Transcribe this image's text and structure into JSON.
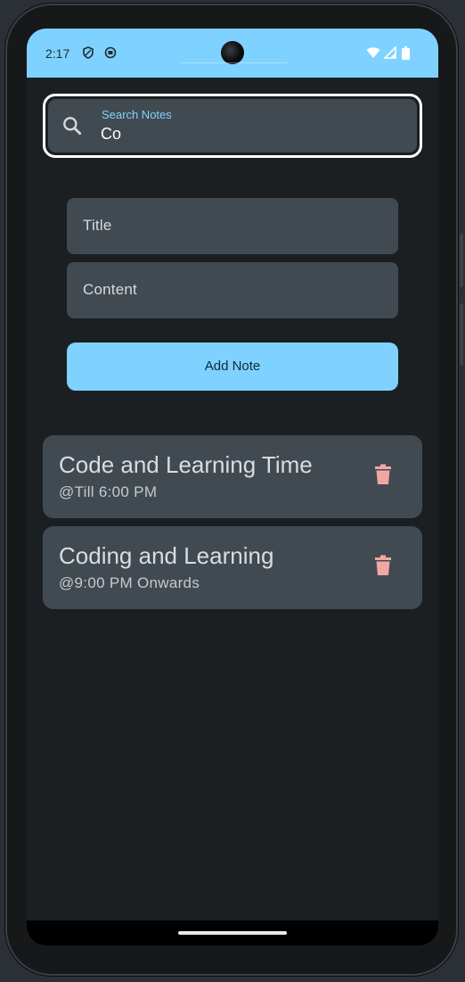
{
  "status_bar": {
    "time": "2:17",
    "color": "#7fd2ff",
    "left_icons": [
      "shield-icon",
      "app-circle-icon"
    ],
    "right_icons": [
      "wifi-icon",
      "signal-icon",
      "battery-icon"
    ]
  },
  "search": {
    "label": "Search Notes",
    "value": "Co",
    "icon": "search-icon"
  },
  "form": {
    "title_placeholder": "Title",
    "content_placeholder": "Content",
    "add_button_label": "Add Note"
  },
  "notes": [
    {
      "title": "Code and Learning Time",
      "content": "@Till 6:00 PM",
      "delete_icon": "trash-icon"
    },
    {
      "title": "Coding and Learning",
      "content": "@9:00 PM Onwards",
      "delete_icon": "trash-icon"
    }
  ],
  "theme": {
    "accent": "#7fd2ff",
    "background": "#1b1f22",
    "surface": "#424a51",
    "delete": "#f2a7a3"
  }
}
